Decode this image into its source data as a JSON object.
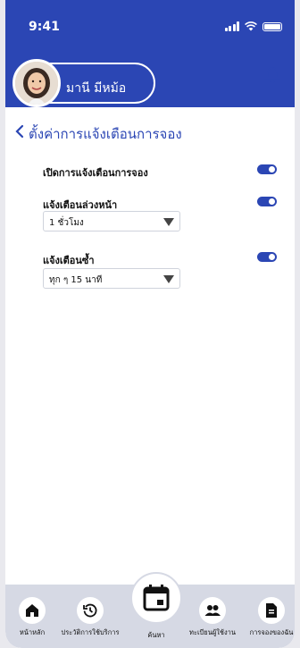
{
  "status_bar": {
    "time": "9:41"
  },
  "profile": {
    "name": "มานี มีหม้อ"
  },
  "page": {
    "title": "ตั้งค่าการแจ้งเตือนการจอง"
  },
  "settings": {
    "enable_label": "เปิดการแจ้งเตือนการจอง",
    "advance_label": "แจ้งเตือนล่วงหน้า",
    "advance_value": "1 ชั่วโมง",
    "repeat_label": "แจ้งเตือนซ้ำ",
    "repeat_value": "ทุก ๆ 15 นาที"
  },
  "nav": {
    "home": "หน้าหลัก",
    "history": "ประวัติการใช้บริการ",
    "search": "ค้นหา",
    "register": "ทะเบียนผู้ใช้งาน",
    "my_bookings": "การจองของฉัน"
  },
  "colors": {
    "primary": "#2b46b4",
    "nav_bg": "#d6d9e4"
  }
}
